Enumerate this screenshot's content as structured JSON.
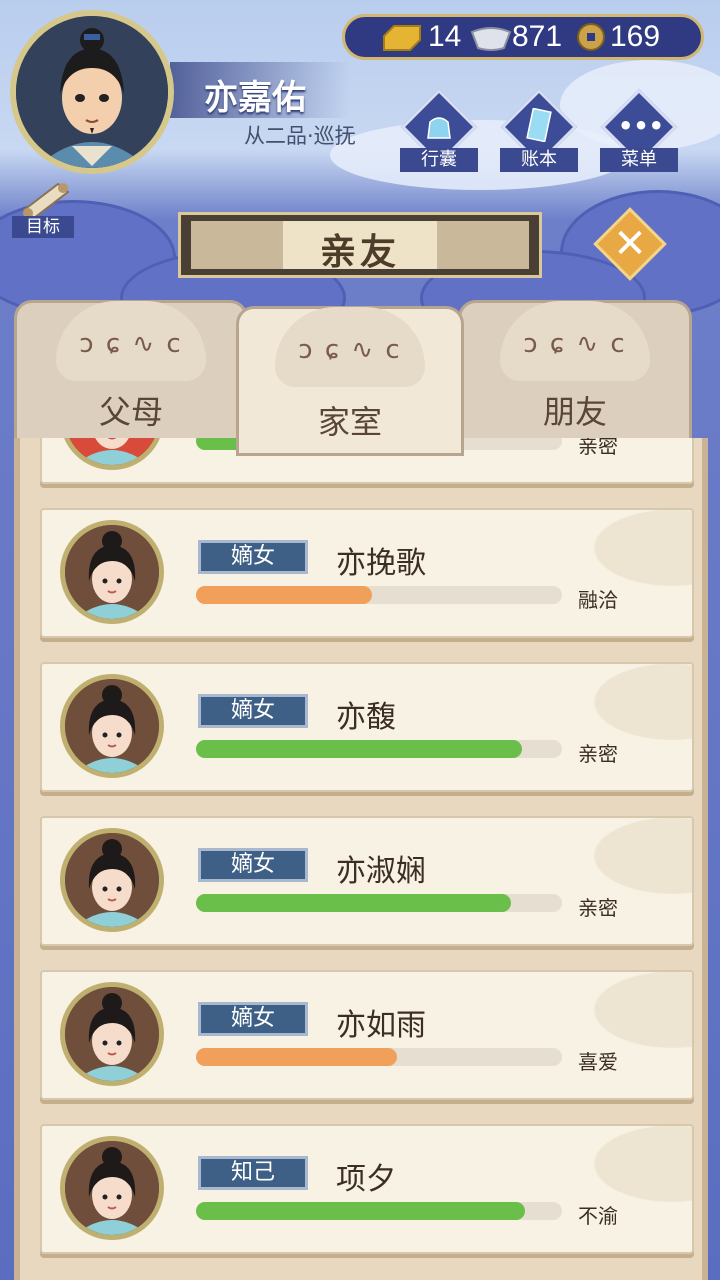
{
  "player": {
    "name": "亦嘉佑",
    "rank": "从二品·巡抚"
  },
  "currency": {
    "gold": "14",
    "silver": "871",
    "coin": "169"
  },
  "menu": {
    "bag": "行囊",
    "ledger": "账本",
    "menu": "菜单",
    "goal": "目标"
  },
  "title": "亲友",
  "close_icon": "close-icon",
  "tabs": [
    {
      "label": "父母"
    },
    {
      "label": "家室"
    },
    {
      "label": "朋友"
    }
  ],
  "active_tab": "家室",
  "relatives": [
    {
      "role": "",
      "name": "",
      "relation": "亲密",
      "progress": 0.7,
      "bar_color": "#6abf4b"
    },
    {
      "role": "嫡女",
      "name": "亦挽歌",
      "relation": "融洽",
      "progress": 0.48,
      "bar_color": "#f0a05a"
    },
    {
      "role": "嫡女",
      "name": "亦馥",
      "relation": "亲密",
      "progress": 0.89,
      "bar_color": "#6abf4b"
    },
    {
      "role": "嫡女",
      "name": "亦淑娴",
      "relation": "亲密",
      "progress": 0.86,
      "bar_color": "#6abf4b"
    },
    {
      "role": "嫡女",
      "name": "亦如雨",
      "relation": "喜爱",
      "progress": 0.55,
      "bar_color": "#f0a05a"
    },
    {
      "role": "知己",
      "name": "项夕",
      "relation": "不渝",
      "progress": 0.9,
      "bar_color": "#6abf4b"
    }
  ]
}
